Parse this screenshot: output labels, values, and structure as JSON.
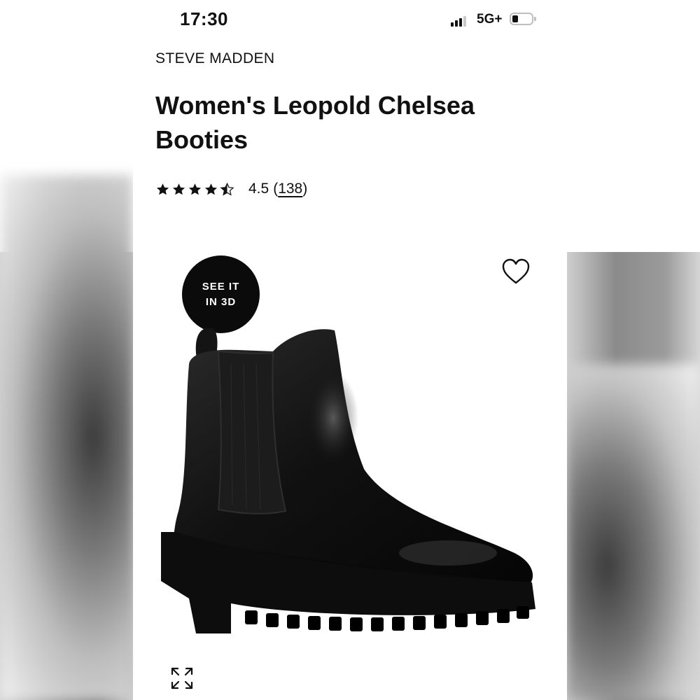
{
  "status_bar": {
    "time": "17:30",
    "network": "5G+",
    "signal_bars": 3,
    "battery_icon": "battery-low-icon"
  },
  "product": {
    "brand": "STEVE MADDEN",
    "title": "Women's Leopold Chelsea Booties",
    "rating": {
      "stars": 4.5,
      "value": "4.5",
      "open_paren": "(",
      "review_count": "138",
      "close_paren": ")"
    },
    "see_3d": {
      "line1": "SEE IT",
      "line2": "IN 3D"
    },
    "image_icon": "black-chelsea-boot-image",
    "wishlist_icon": "heart-outline-icon",
    "expand_icon": "expand-arrows-icon"
  },
  "colors": {
    "text": "#111111",
    "badge_bg": "#0b0b0b",
    "badge_text": "#ffffff"
  }
}
